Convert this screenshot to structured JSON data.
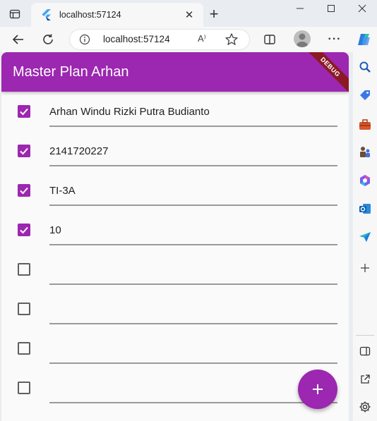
{
  "browser": {
    "tab": {
      "title": "localhost:57124",
      "close_glyph": "✕"
    },
    "new_tab_glyph": "+",
    "address_bar": {
      "url": "localhost:57124",
      "read_aloud": "A⁾"
    },
    "more_glyph": "···"
  },
  "app": {
    "title": "Master Plan Arhan",
    "debug_banner": "DEBUG",
    "accent_color": "#9c27b0",
    "tasks": [
      {
        "text": "Arhan Windu Rizki Putra Budianto",
        "done": true
      },
      {
        "text": "2141720227",
        "done": true
      },
      {
        "text": "TI-3A",
        "done": true
      },
      {
        "text": "10",
        "done": true
      },
      {
        "text": "",
        "done": false
      },
      {
        "text": "",
        "done": false
      },
      {
        "text": "",
        "done": false
      },
      {
        "text": "",
        "done": false
      }
    ]
  },
  "sidebar_icons": [
    "search-icon",
    "tag-icon",
    "toolbox-icon",
    "chess-icon",
    "m365-icon",
    "outlook-icon",
    "send-icon",
    "add-icon",
    "split-screen-icon",
    "open-external-icon",
    "settings-icon"
  ]
}
